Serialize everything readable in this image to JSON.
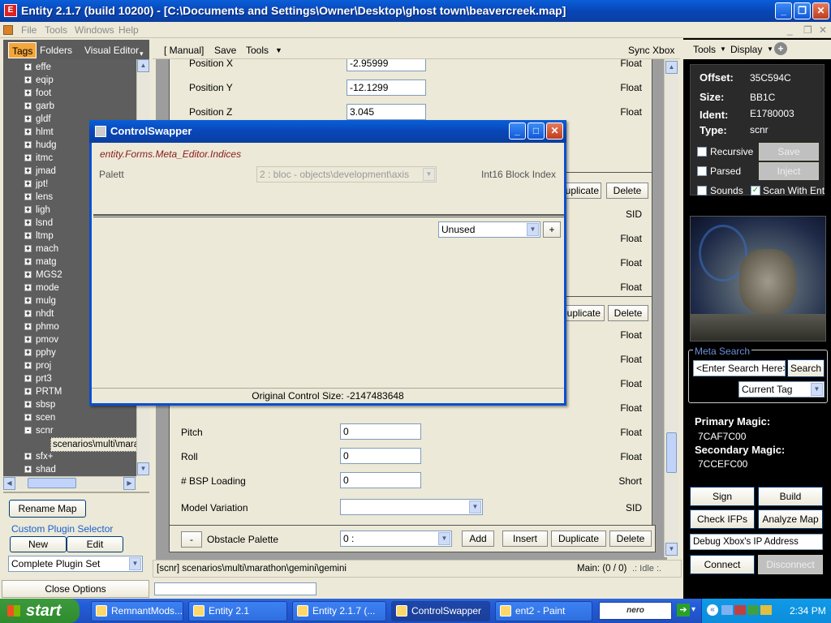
{
  "window": {
    "title": "Entity  2.1.7 (build 10200) - [C:\\Documents and Settings\\Owner\\Desktop\\ghost town\\beavercreek.map]"
  },
  "menu": [
    "File",
    "Tools",
    "Windows",
    "Help"
  ],
  "left": {
    "tabs": [
      "Tags",
      "Folders",
      "Visual Editor"
    ],
    "tree": [
      "effe",
      "eqip",
      "foot",
      "garb",
      "gldf",
      "hlmt",
      "hudg",
      "itmc",
      "jmad",
      "jpt!",
      "lens",
      "ligh",
      "lsnd",
      "ltmp",
      "mach",
      "matg",
      "MGS2",
      "mode",
      "mulg",
      "nhdt",
      "phmo",
      "pmov",
      "pphy",
      "proj",
      "prt3",
      "PRTM",
      "sbsp",
      "scen",
      "scnr"
    ],
    "tree_child": "scenarios\\multi\\marat",
    "tree_after": [
      "sfx+",
      "shad"
    ],
    "rename_map": "Rename Map",
    "custom_plugin": "Custom Plugin Selector",
    "new_label": "New",
    "edit_label": "Edit",
    "plugin_set": "Complete Plugin Set",
    "close_options": "Close Options"
  },
  "center": {
    "toolbar": {
      "manual": "[ Manual]",
      "save": "Save",
      "tools": "Tools",
      "sync": "Sync Xbox"
    },
    "top_rows": [
      {
        "label": "Position X",
        "value": "-2.95999",
        "type": "Float"
      },
      {
        "label": "Position Y",
        "value": "-12.1299",
        "type": "Float"
      },
      {
        "label": "Position Z",
        "value": "3.045",
        "type": "Float"
      }
    ],
    "duplicate": "Duplicate",
    "delete": "Delete",
    "duplicate_partial": "Duplicate",
    "sid": "SID",
    "float": "Float",
    "mid_rows": [
      {
        "label": "Pitch",
        "value": "0",
        "type": "Float"
      },
      {
        "label": "Roll",
        "value": "0",
        "type": "Float"
      },
      {
        "label": "# BSP Loading",
        "value": "0",
        "type": "Short"
      },
      {
        "label": "Model Variation",
        "value": "",
        "type": "SID"
      }
    ],
    "obstacle": {
      "minus": "-",
      "label": "Obstacle Palette",
      "value": "0 :",
      "add": "Add",
      "insert": "Insert",
      "duplicate": "Duplicate",
      "delete": "Delete"
    }
  },
  "status": {
    "path": "[scnr]  scenarios\\multi\\marathon\\gemini\\gemini",
    "main": "Main: (0 / 0)",
    "idle": ".: Idle :."
  },
  "dialog": {
    "title": "ControlSwapper",
    "type_name": "entity.Forms.Meta_Editor.Indices",
    "palett_label": "Palett",
    "palett_value": "2 : bloc - objects\\development\\axis",
    "index_type": "Int16 Block Index",
    "unused": "Unused",
    "plus": "+",
    "original_size": "Original Control Size: -2147483648"
  },
  "right": {
    "tools": "Tools",
    "display": "Display",
    "offset_label": "Offset:",
    "offset": "35C594C",
    "size_label": "Size:",
    "size": "BB1C",
    "ident_label": "Ident:",
    "ident": "E1780003",
    "type_label": "Type:",
    "type": "scnr",
    "recursive": "Recursive",
    "save": "Save",
    "parsed": "Parsed",
    "inject": "Inject",
    "sounds": "Sounds",
    "scan": "Scan With Ent",
    "meta_search": "Meta Search",
    "search_placeholder": "<Enter Search Here>",
    "search_btn": "Search",
    "current_tag": "Current Tag",
    "primary_label": "Primary Magic:",
    "primary": "7CAF7C00",
    "secondary_label": "Secondary Magic:",
    "secondary": "7CCEFC00",
    "sign": "Sign",
    "build": "Build",
    "check_ifps": "Check IFPs",
    "analyze": "Analyze Map",
    "debug_ip": "Debug  Xbox's  IP  Address",
    "connect": "Connect",
    "disconnect": "Disconnect"
  },
  "taskbar": {
    "start": "start",
    "tasks": [
      "RemnantMods...",
      "Entity 2.1",
      "Entity  2.1.7 (...",
      "ControlSwapper",
      "ent2 - Paint"
    ],
    "clock": "2:34 PM"
  }
}
